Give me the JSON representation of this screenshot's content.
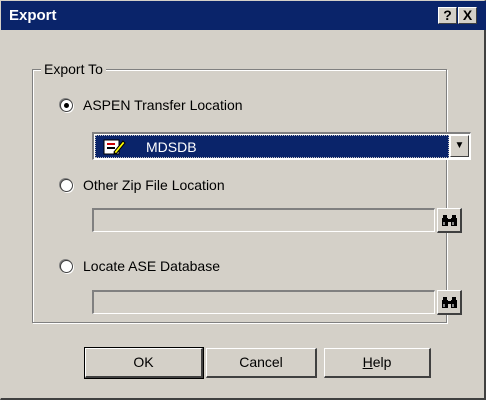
{
  "window": {
    "title": "Export",
    "help_button": "?",
    "close_button": "X"
  },
  "group": {
    "label": "Export To"
  },
  "options": [
    {
      "label": "ASPEN Transfer Location",
      "checked": true
    },
    {
      "label": "Other Zip File Location",
      "checked": false
    },
    {
      "label": "Locate ASE Database",
      "checked": false
    }
  ],
  "combo": {
    "value": "MDSDB",
    "icon": "database-pencil-icon"
  },
  "zip_field": {
    "value": ""
  },
  "ase_field": {
    "value": ""
  },
  "buttons": {
    "ok": "OK",
    "cancel": "Cancel",
    "help_prefix": "",
    "help_mnemonic": "H",
    "help_rest": "elp"
  },
  "icons": {
    "browse": "binoculars-icon",
    "dropdown": "chevron-down-icon"
  },
  "colors": {
    "titlebar": "#0a246a",
    "face": "#d4d0c8",
    "selection": "#0a246a"
  }
}
